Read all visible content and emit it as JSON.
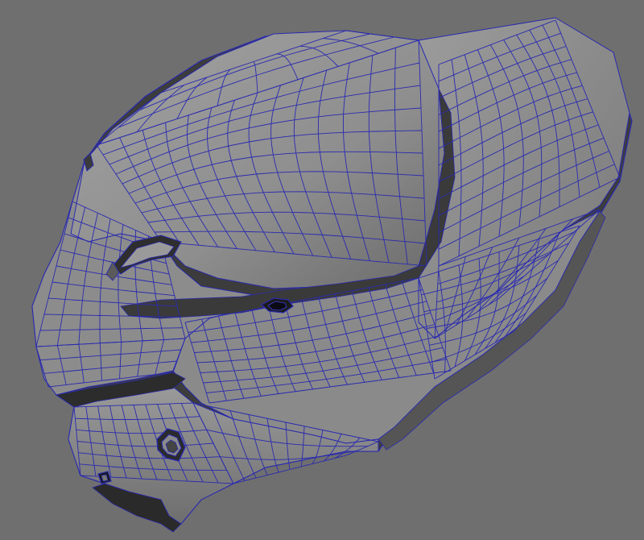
{
  "viewport": {
    "background_color": "#6f6f6f",
    "wire_color": "#2a2ab0",
    "shade_light": "#9a9a9a",
    "shade_mid": "#7c7c7c",
    "shade_dark": "#4a4a4a",
    "shade_deep": "#2a2a2a"
  }
}
